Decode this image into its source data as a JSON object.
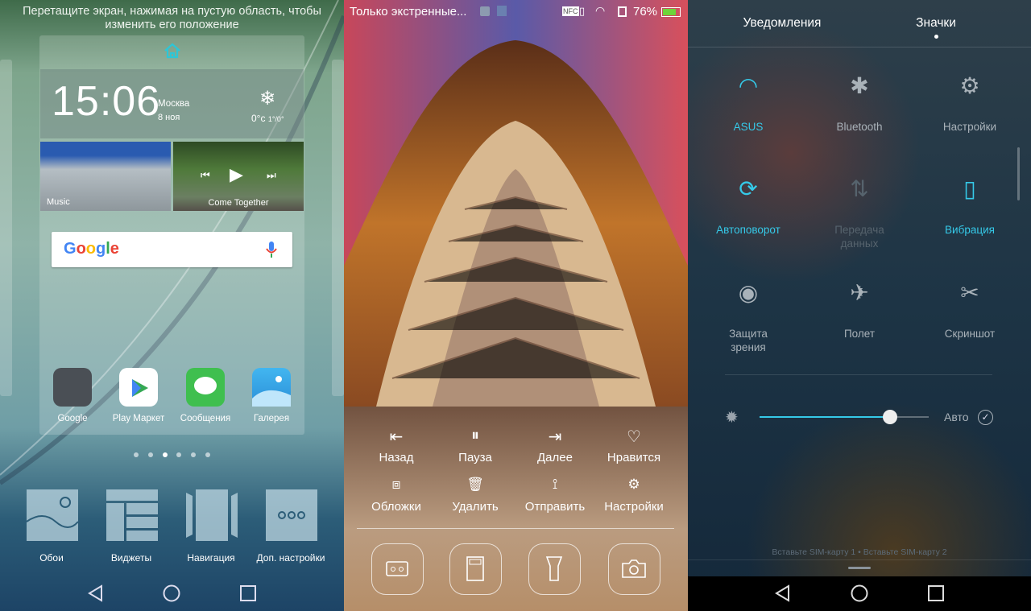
{
  "home_editor": {
    "hint": "Перетащите экран, нажимая на пустую область, чтобы изменить его положение",
    "clock": {
      "time": "15:06",
      "city": "Москва",
      "date": "8 ноя",
      "temp": "0°c",
      "range": "1°/0°"
    },
    "music_tile": "Music",
    "player_tile": "Come Together",
    "search": {
      "logo": "Google",
      "mic": "mic-icon"
    },
    "apps": [
      {
        "label": "Google"
      },
      {
        "label": "Play Маркет"
      },
      {
        "label": "Сообщения"
      },
      {
        "label": "Галерея"
      }
    ],
    "page_count": 6,
    "active_page": 3,
    "options": [
      {
        "label": "Обои"
      },
      {
        "label": "Виджеты"
      },
      {
        "label": "Навигация"
      },
      {
        "label": "Доп. настройки"
      }
    ]
  },
  "lockscreen": {
    "status": {
      "text": "Только экстренные...",
      "battery": "76%",
      "icons": [
        "nfc-icon",
        "vibrate-icon",
        "wifi-icon",
        "sim-icon",
        "battery-icon"
      ]
    },
    "row1": [
      {
        "label": "Назад",
        "icon": "skip-back-icon"
      },
      {
        "label": "Пауза",
        "icon": "pause-icon"
      },
      {
        "label": "Далее",
        "icon": "skip-next-icon"
      },
      {
        "label": "Нравится",
        "icon": "heart-icon"
      }
    ],
    "row2": [
      {
        "label": "Обложки",
        "icon": "briefcase-icon"
      },
      {
        "label": "Удалить",
        "icon": "trash-icon"
      },
      {
        "label": "Отправить",
        "icon": "share-icon"
      },
      {
        "label": "Настройки",
        "icon": "gear-icon"
      }
    ],
    "shortcuts": [
      "recorder-icon",
      "calculator-icon",
      "flashlight-icon",
      "camera-icon"
    ]
  },
  "quick_settings": {
    "tabs": [
      {
        "label": "Уведомления"
      },
      {
        "label": "Значки",
        "active": true
      }
    ],
    "tiles": [
      {
        "label": "ASUS",
        "active": true
      },
      {
        "label": "Bluetooth",
        "active": false
      },
      {
        "label": "Настройки",
        "active": false
      },
      {
        "label": "Автоповорот",
        "active": true
      },
      {
        "label": "Передача данных",
        "active": false,
        "disabled": true
      },
      {
        "label": "Вибрация",
        "active": true
      },
      {
        "label": "Защита зрения",
        "active": false
      },
      {
        "label": "Полет",
        "active": false
      },
      {
        "label": "Скриншот",
        "active": false
      }
    ],
    "brightness": {
      "value": 0.77,
      "auto_label": "Авто",
      "auto": true
    },
    "sim_text": "Вставьте SIM-карту 1 • Вставьте SIM-карту 2",
    "accent": "#35c9e8"
  }
}
